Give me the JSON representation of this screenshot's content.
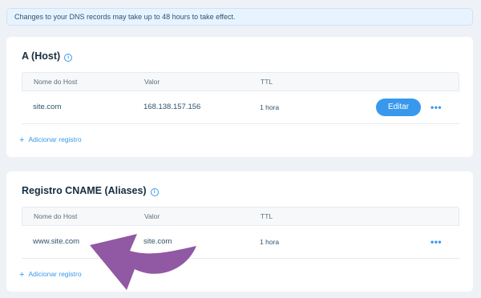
{
  "notice": {
    "text": "Changes to your DNS records may take up to 48 hours to take effect."
  },
  "sections": [
    {
      "title": "A (Host)",
      "columns": [
        "Nome do Host",
        "Valor",
        "TTL"
      ],
      "rows": [
        {
          "host": "site.com",
          "value": "168.138.157.156",
          "ttl": "1 hora",
          "edit_label": "Editar",
          "more": "•••"
        }
      ],
      "add_label": "Adicionar registro"
    },
    {
      "title": "Registro CNAME (Aliases)",
      "columns": [
        "Nome do Host",
        "Valor",
        "TTL"
      ],
      "rows": [
        {
          "host": "www.site.com",
          "value": "site.com",
          "ttl": "1 hora",
          "more": "•••"
        }
      ],
      "add_label": "Adicionar registro"
    }
  ],
  "icons": {
    "info": "info-icon",
    "more": "more-options-icon",
    "add": "plus-icon",
    "annotation": "curved-arrow-annotation"
  },
  "colors": {
    "accent": "#3899ec",
    "annotation": "#8b4f9e",
    "background": "#eef2f6"
  }
}
